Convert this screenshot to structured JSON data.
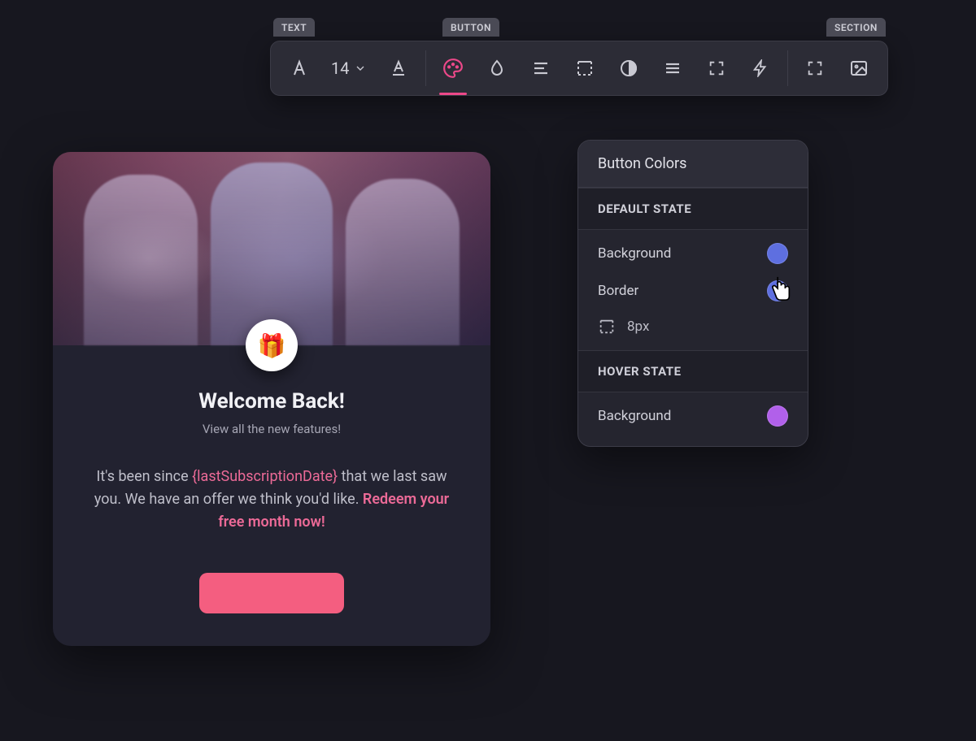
{
  "toolbar": {
    "tabs": {
      "text": "TEXT",
      "button": "BUTTON",
      "section": "SECTION"
    },
    "font_size": "14"
  },
  "preview": {
    "avatar_emoji": "🎁",
    "title": "Welcome Back!",
    "subtitle": "View all the new features!",
    "body_before": "It's been since ",
    "body_token": "{lastSubscriptionDate}",
    "body_mid": " that we last saw you. We have an offer we think you'd like. ",
    "body_cta": "Redeem your free month now!",
    "button_label": ""
  },
  "panel": {
    "title": "Button Colors",
    "default_heading": "DEFAULT STATE",
    "hover_heading": "HOVER STATE",
    "background_label": "Background",
    "border_label": "Border",
    "border_width": "8px",
    "colors": {
      "default_background": "#5e6fe0",
      "default_border": "#5e6fe0",
      "hover_background": "#b160ea"
    }
  }
}
